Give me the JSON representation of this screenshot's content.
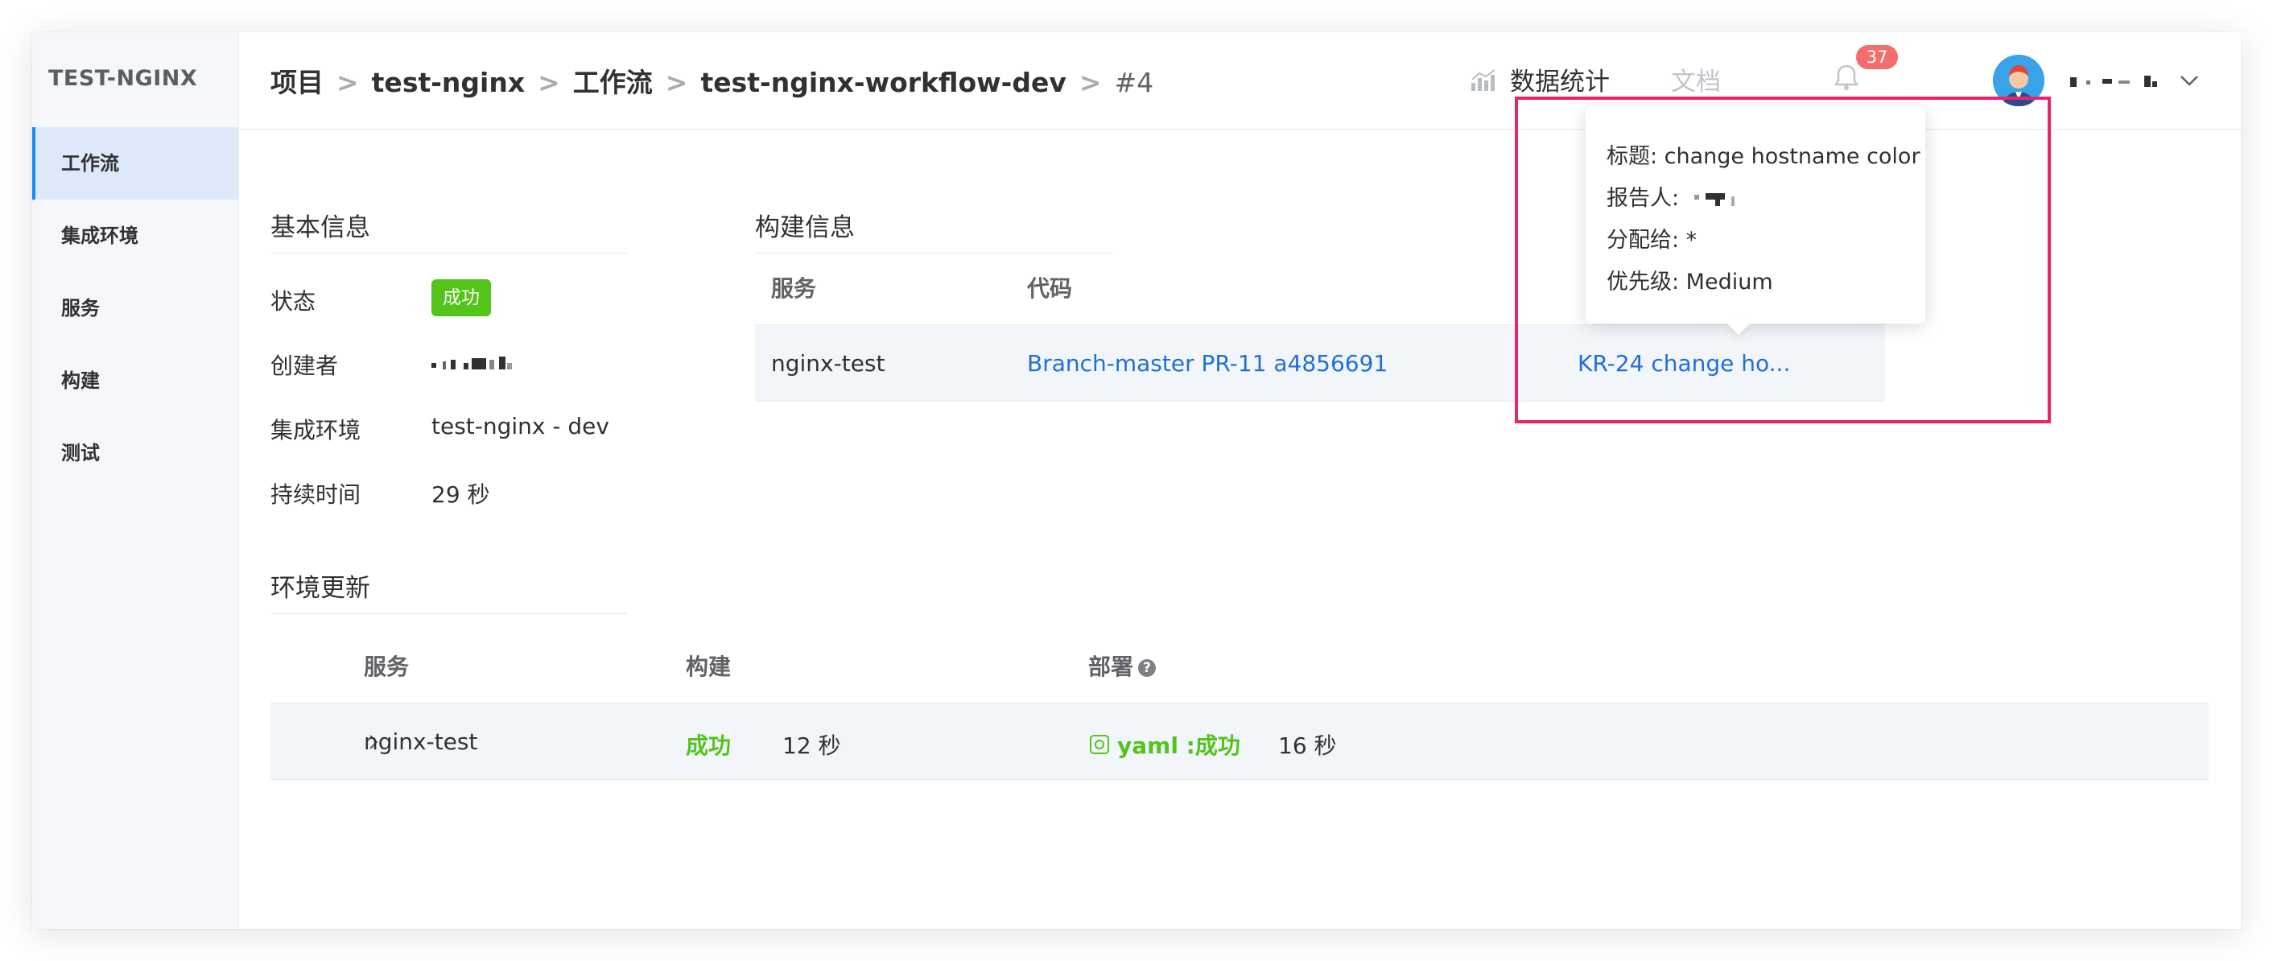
{
  "sidebar": {
    "brand": "TEST-NGINX",
    "items": [
      {
        "label": "工作流"
      },
      {
        "label": "集成环境"
      },
      {
        "label": "服务"
      },
      {
        "label": "构建"
      },
      {
        "label": "测试"
      }
    ]
  },
  "header": {
    "breadcrumb": [
      "项目",
      "test-nginx",
      "工作流",
      "test-nginx-workflow-dev",
      "#4"
    ],
    "separator": ">",
    "stats_label": "数据统计",
    "doc_label": "文档",
    "notification_count": "37"
  },
  "basic_info": {
    "title": "基本信息",
    "status_label": "状态",
    "status_value": "成功",
    "creator_label": "创建者",
    "env_label": "集成环境",
    "env_value": "test-nginx - dev",
    "duration_label": "持续时间",
    "duration_value": "29 秒"
  },
  "build_info": {
    "title": "构建信息",
    "columns": [
      "服务",
      "代码"
    ],
    "rows": [
      {
        "service": "nginx-test",
        "code": "Branch-master PR-11 a4856691",
        "issue": "KR-24 change ho..."
      }
    ]
  },
  "env_update": {
    "title": "环境更新",
    "columns": [
      "服务",
      "构建",
      "部署"
    ],
    "rows": [
      {
        "service": "nginx-test",
        "build_status": "成功",
        "build_time": "12 秒",
        "deploy_status": "yaml :成功",
        "deploy_time": "16 秒"
      }
    ]
  },
  "popover": {
    "title_line": "标题: change hostname color",
    "reporter_label": "报告人:",
    "assignee_line": "分配给: *",
    "priority_line": "优先级: Medium"
  },
  "colors": {
    "accent": "#1989fa",
    "success": "#52c41a",
    "link": "#1f6fd8",
    "badge": "#f56c6c",
    "highlight": "#e8246f"
  }
}
